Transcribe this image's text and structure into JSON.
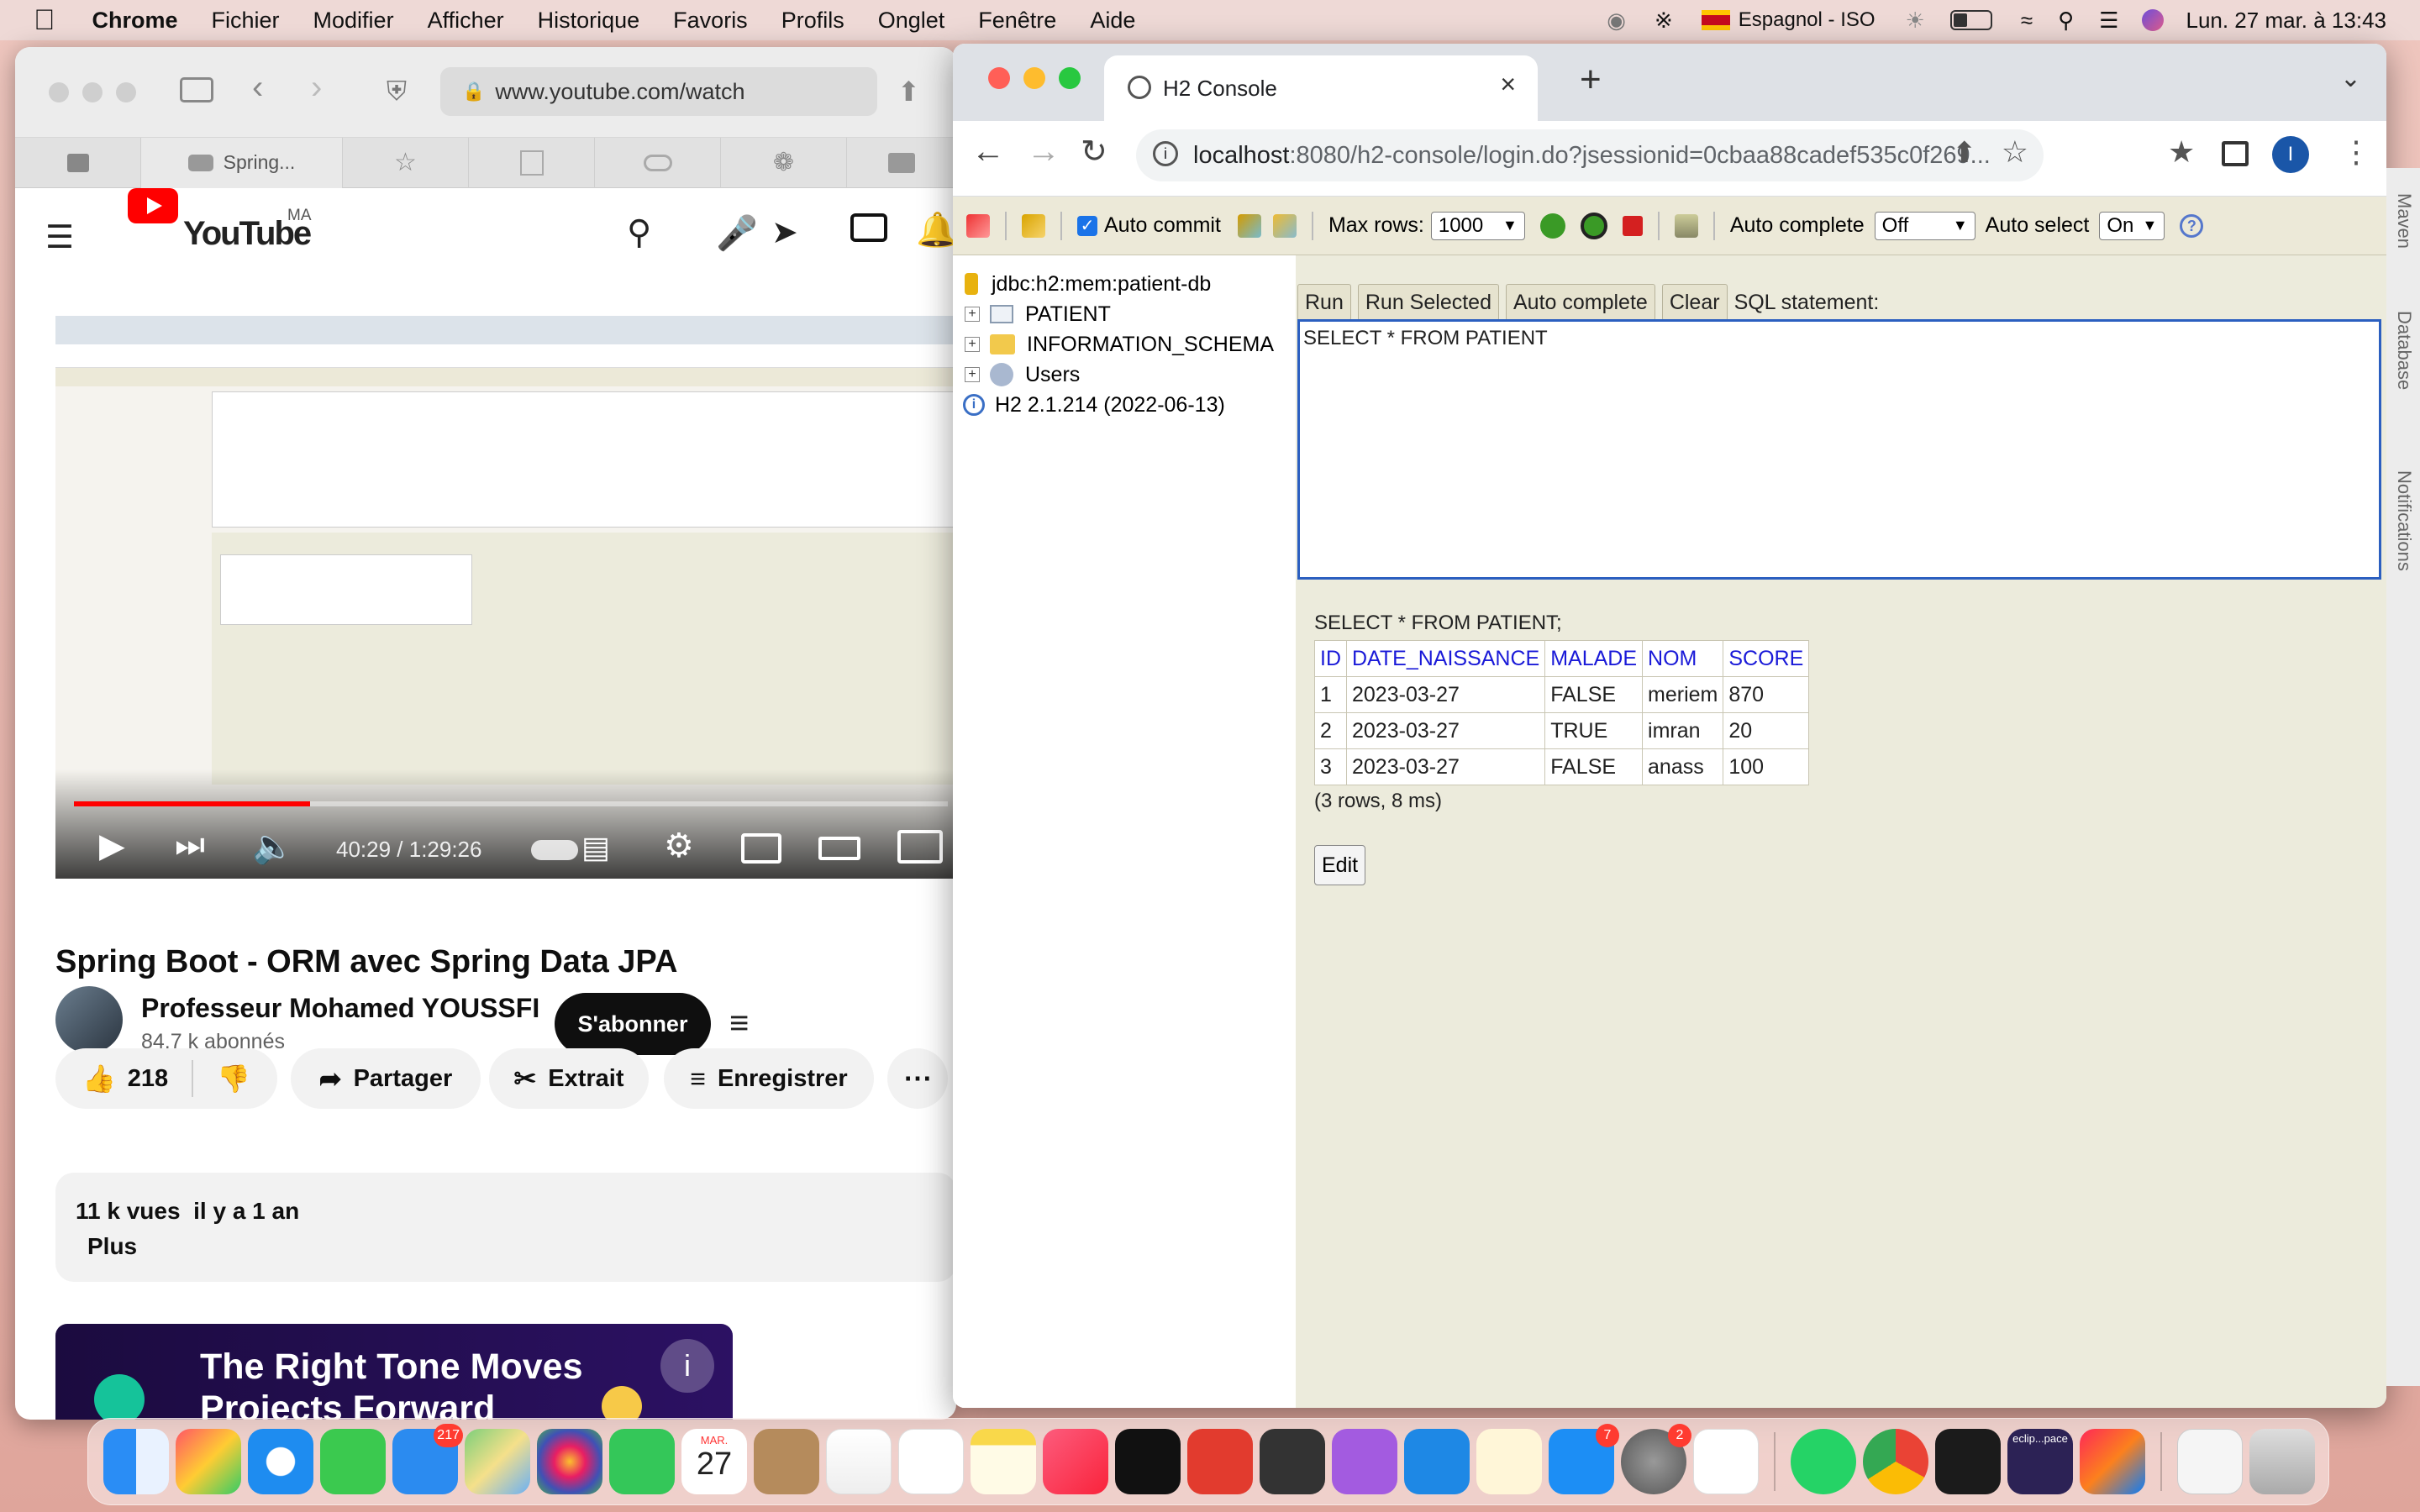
{
  "menubar": {
    "app": "Chrome",
    "items": [
      "Fichier",
      "Modifier",
      "Afficher",
      "Historique",
      "Favoris",
      "Profils",
      "Onglet",
      "Fenêtre",
      "Aide"
    ],
    "input_source": "Espagnol - ISO",
    "datetime": "Lun. 27 mar. à 13:43"
  },
  "safari": {
    "url": "www.youtube.com/watch",
    "tabs": [
      {
        "label": ""
      },
      {
        "label": "Spring..."
      },
      {
        "label": ""
      },
      {
        "label": ""
      },
      {
        "label": ""
      },
      {
        "label": ""
      },
      {
        "label": ""
      }
    ],
    "youtube": {
      "country": "MA",
      "logo_text": "YouTube",
      "video_time": "40:29 / 1:29:26",
      "progress": 0.27,
      "title": "Spring Boot - ORM avec Spring Data JPA",
      "channel": "Professeur Mohamed YOUSSFI",
      "subscribers": "84,7 k abonnés",
      "subscribe_label": "S'abonner",
      "likes": "218",
      "share_label": "Partager",
      "clip_label": "Extrait",
      "save_label": "Enregistrer",
      "views": "11 k vues",
      "age": "il y a 1 an",
      "more_label": "Plus",
      "ad_text": "The Right Tone Moves Projects Forward"
    }
  },
  "chrome": {
    "tab_title": "H2 Console",
    "url_host": "localhost",
    "url_rest": ":8080/h2-console/login.do?jsessionid=0cbaa88cadef535c0f269...",
    "profile_initial": "I"
  },
  "h2": {
    "toolbar": {
      "auto_commit_label": "Auto commit",
      "max_rows_label": "Max rows:",
      "max_rows_value": "1000",
      "auto_complete_label": "Auto complete",
      "auto_complete_value": "Off",
      "auto_select_label": "Auto select",
      "auto_select_value": "On"
    },
    "tree": {
      "connection": "jdbc:h2:mem:patient-db",
      "nodes": [
        "PATIENT",
        "INFORMATION_SCHEMA",
        "Users"
      ],
      "version": "H2 2.1.214 (2022-06-13)"
    },
    "buttons": {
      "run": "Run",
      "run_selected": "Run Selected",
      "auto_complete": "Auto complete",
      "clear": "Clear",
      "sql_label": "SQL statement:"
    },
    "sql": "SELECT * FROM PATIENT",
    "result": {
      "query": "SELECT * FROM PATIENT;",
      "columns": [
        "ID",
        "DATE_NAISSANCE",
        "MALADE",
        "NOM",
        "SCORE"
      ],
      "rows": [
        [
          "1",
          "2023-03-27",
          "FALSE",
          "meriem",
          "870"
        ],
        [
          "2",
          "2023-03-27",
          "TRUE",
          "imran",
          "20"
        ],
        [
          "3",
          "2023-03-27",
          "FALSE",
          "anass",
          "100"
        ]
      ],
      "summary": "(3 rows, 8 ms)",
      "edit_label": "Edit"
    }
  },
  "side_panel": [
    "Maven",
    "Database",
    "Notifications"
  ],
  "dock": {
    "mail_badge": "217",
    "calendar_month": "MAR.",
    "calendar_day": "27",
    "appstore_badge": "7",
    "settings_badge": "2",
    "eclipse_label": "eclip...pace"
  }
}
